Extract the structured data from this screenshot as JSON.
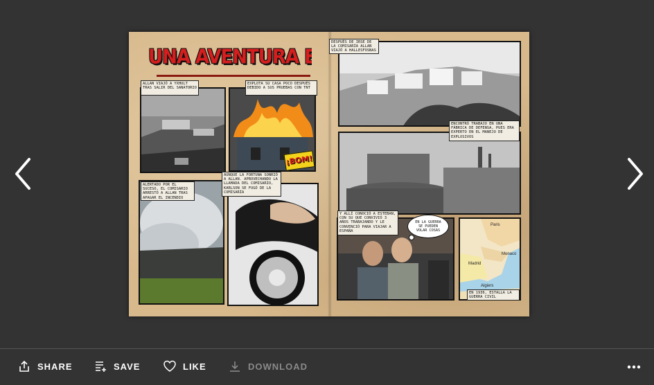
{
  "viewer": {
    "prev_icon": "chevron-left-icon",
    "next_icon": "chevron-right-icon"
  },
  "comic": {
    "title": "UNA AVENTURA EXPLOSIVA",
    "panels": [
      {
        "caption": "ALLAN VIAJÓ A YXHULT TRAS SALIR DEL SANATORIO"
      },
      {
        "caption": "EXPLOTA SU CASA POCO DESPUÉS DEBIDO A SUS PRUEBAS CON TNT",
        "sfx": "¡BOM!"
      },
      {
        "caption": "ALERTADO POR EL SUCESO, EL COMISARIO ARRESTÓ A ALLAN TRAS APAGAR EL INCENDIO"
      },
      {
        "caption": "AUNQUE LA FORTUNA SONRIÓ A ALLAN. APROVECHANDO LA LLAMADA DEL COMISARIO, KARLSON SE FUGÓ DE LA COMISARÍA"
      },
      {
        "caption": "DESPUÉS DE IRSE DE LA COMISARÍA ALLAN VIAJÓ A HALLESFOSNAS"
      },
      {
        "caption": "ENCONTRÓ TRABAJO EN UNA FÁBRICA DE DEFENSA, PUES ERA EXPERTO EN EL MANEJO DE EXPLOSIVOS"
      },
      {
        "caption": "Y ALLÍ CONOCIÓ A ESTEBAN, CON SU QUE CONVIVIÓ 3 AÑOS TRABAJANDO Y LE CONVENCIÓ PARA VIAJAR A ESPAÑA",
        "bubble": "EN LA GUERRA SE PUEDEN VOLAR COSAS"
      },
      {
        "caption": "EN 1936, ESTALLA LA GUERRA CIVIL",
        "map_labels": [
          "Paris",
          "Monaco",
          "Madrid",
          "Algiers"
        ]
      }
    ]
  },
  "toolbar": {
    "share_label": "SHARE",
    "save_label": "SAVE",
    "like_label": "LIKE",
    "download_label": "DOWNLOAD",
    "more_icon": "more-horizontal-icon"
  }
}
